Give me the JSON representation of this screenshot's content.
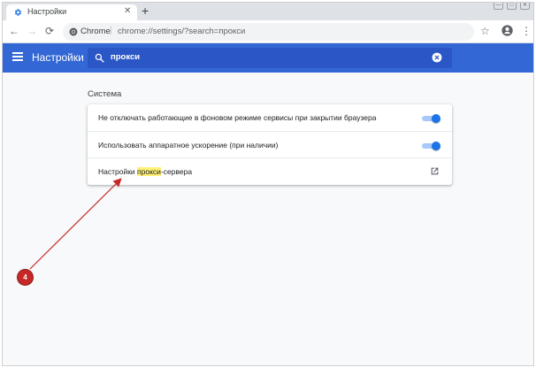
{
  "browser": {
    "tab": {
      "title": "Настройки",
      "close": "✕"
    },
    "new_tab": "+",
    "window_buttons": [
      "—",
      "□",
      "✕"
    ],
    "nav": {
      "back": "←",
      "forward": "→",
      "reload": "⟳"
    },
    "omnibox": {
      "origin": "Chrome",
      "separator": "|",
      "url": "chrome://settings/?search=прокси"
    },
    "star": "☆",
    "menu": "⋮"
  },
  "settings_header": {
    "title": "Настройки",
    "search": {
      "query": "прокси"
    }
  },
  "content": {
    "section_title": "Система",
    "rows": [
      {
        "label": "Не отключать работающие в фоновом режиме сервисы при закрытии браузера",
        "control": "toggle",
        "enabled": true
      },
      {
        "label": "Использовать аппаратное ускорение (при наличии)",
        "control": "toggle",
        "enabled": true
      },
      {
        "label_before": "Настройки ",
        "label_highlight": "прокси",
        "label_after": "-сервера",
        "control": "external-link"
      }
    ]
  },
  "annotation": {
    "marker": "4",
    "color": "#c62828"
  },
  "colors": {
    "header": "#3367d6",
    "search_box": "#2a56c6",
    "toggle_on": "#1a73e8",
    "highlight": "#fff176"
  },
  "icons": [
    "settings-gear-icon",
    "back-arrow-icon",
    "forward-arrow-icon",
    "reload-icon",
    "chrome-logo-icon",
    "star-icon",
    "account-icon",
    "kebab-menu-icon",
    "hamburger-menu-icon",
    "search-icon",
    "clear-search-icon",
    "external-link-icon"
  ]
}
